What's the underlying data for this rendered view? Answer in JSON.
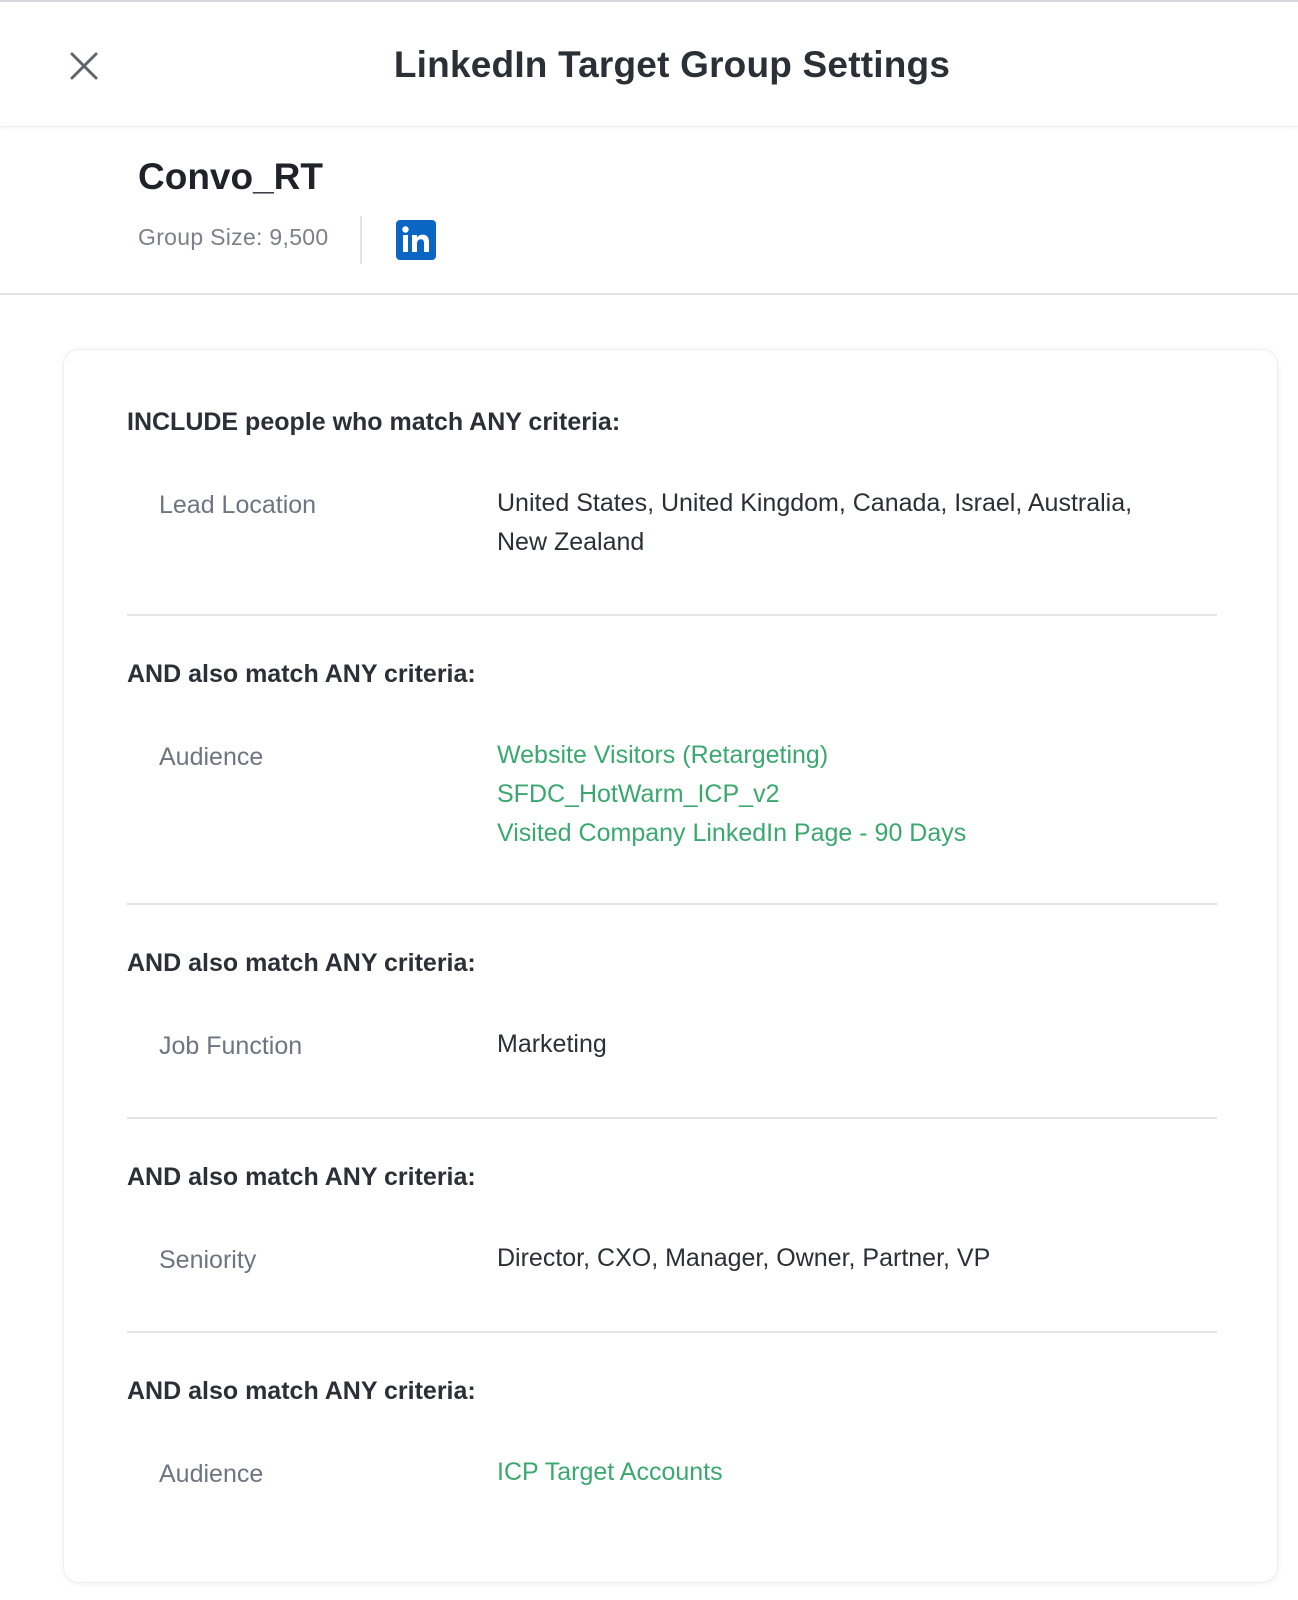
{
  "header": {
    "title": "LinkedIn Target Group Settings",
    "close_icon": "close-icon"
  },
  "group": {
    "name": "Convo_RT",
    "size_text": "Group Size: 9,500",
    "platform_icon": "linkedin-icon"
  },
  "sections": [
    {
      "title": "INCLUDE people who match ANY criteria:",
      "label": "Lead Location",
      "value_text": "United States, United Kingdom, Canada, Israel, Australia, New Zealand"
    },
    {
      "title": "AND also match ANY criteria:",
      "label": "Audience",
      "value_links": [
        "Website Visitors (Retargeting)",
        "SFDC_HotWarm_ICP_v2",
        "Visited Company LinkedIn Page - 90 Days"
      ]
    },
    {
      "title": "AND also match ANY criteria:",
      "label": "Job Function",
      "value_text": "Marketing"
    },
    {
      "title": "AND also match ANY criteria:",
      "label": "Seniority",
      "value_text": "Director, CXO, Manager, Owner, Partner, VP"
    },
    {
      "title": "AND also match ANY criteria:",
      "label": "Audience",
      "value_links": [
        "ICP Target Accounts"
      ]
    }
  ],
  "colors": {
    "link": "#3aa86f",
    "linkedin_blue": "#0a66c2",
    "label_gray": "#6e7580"
  }
}
